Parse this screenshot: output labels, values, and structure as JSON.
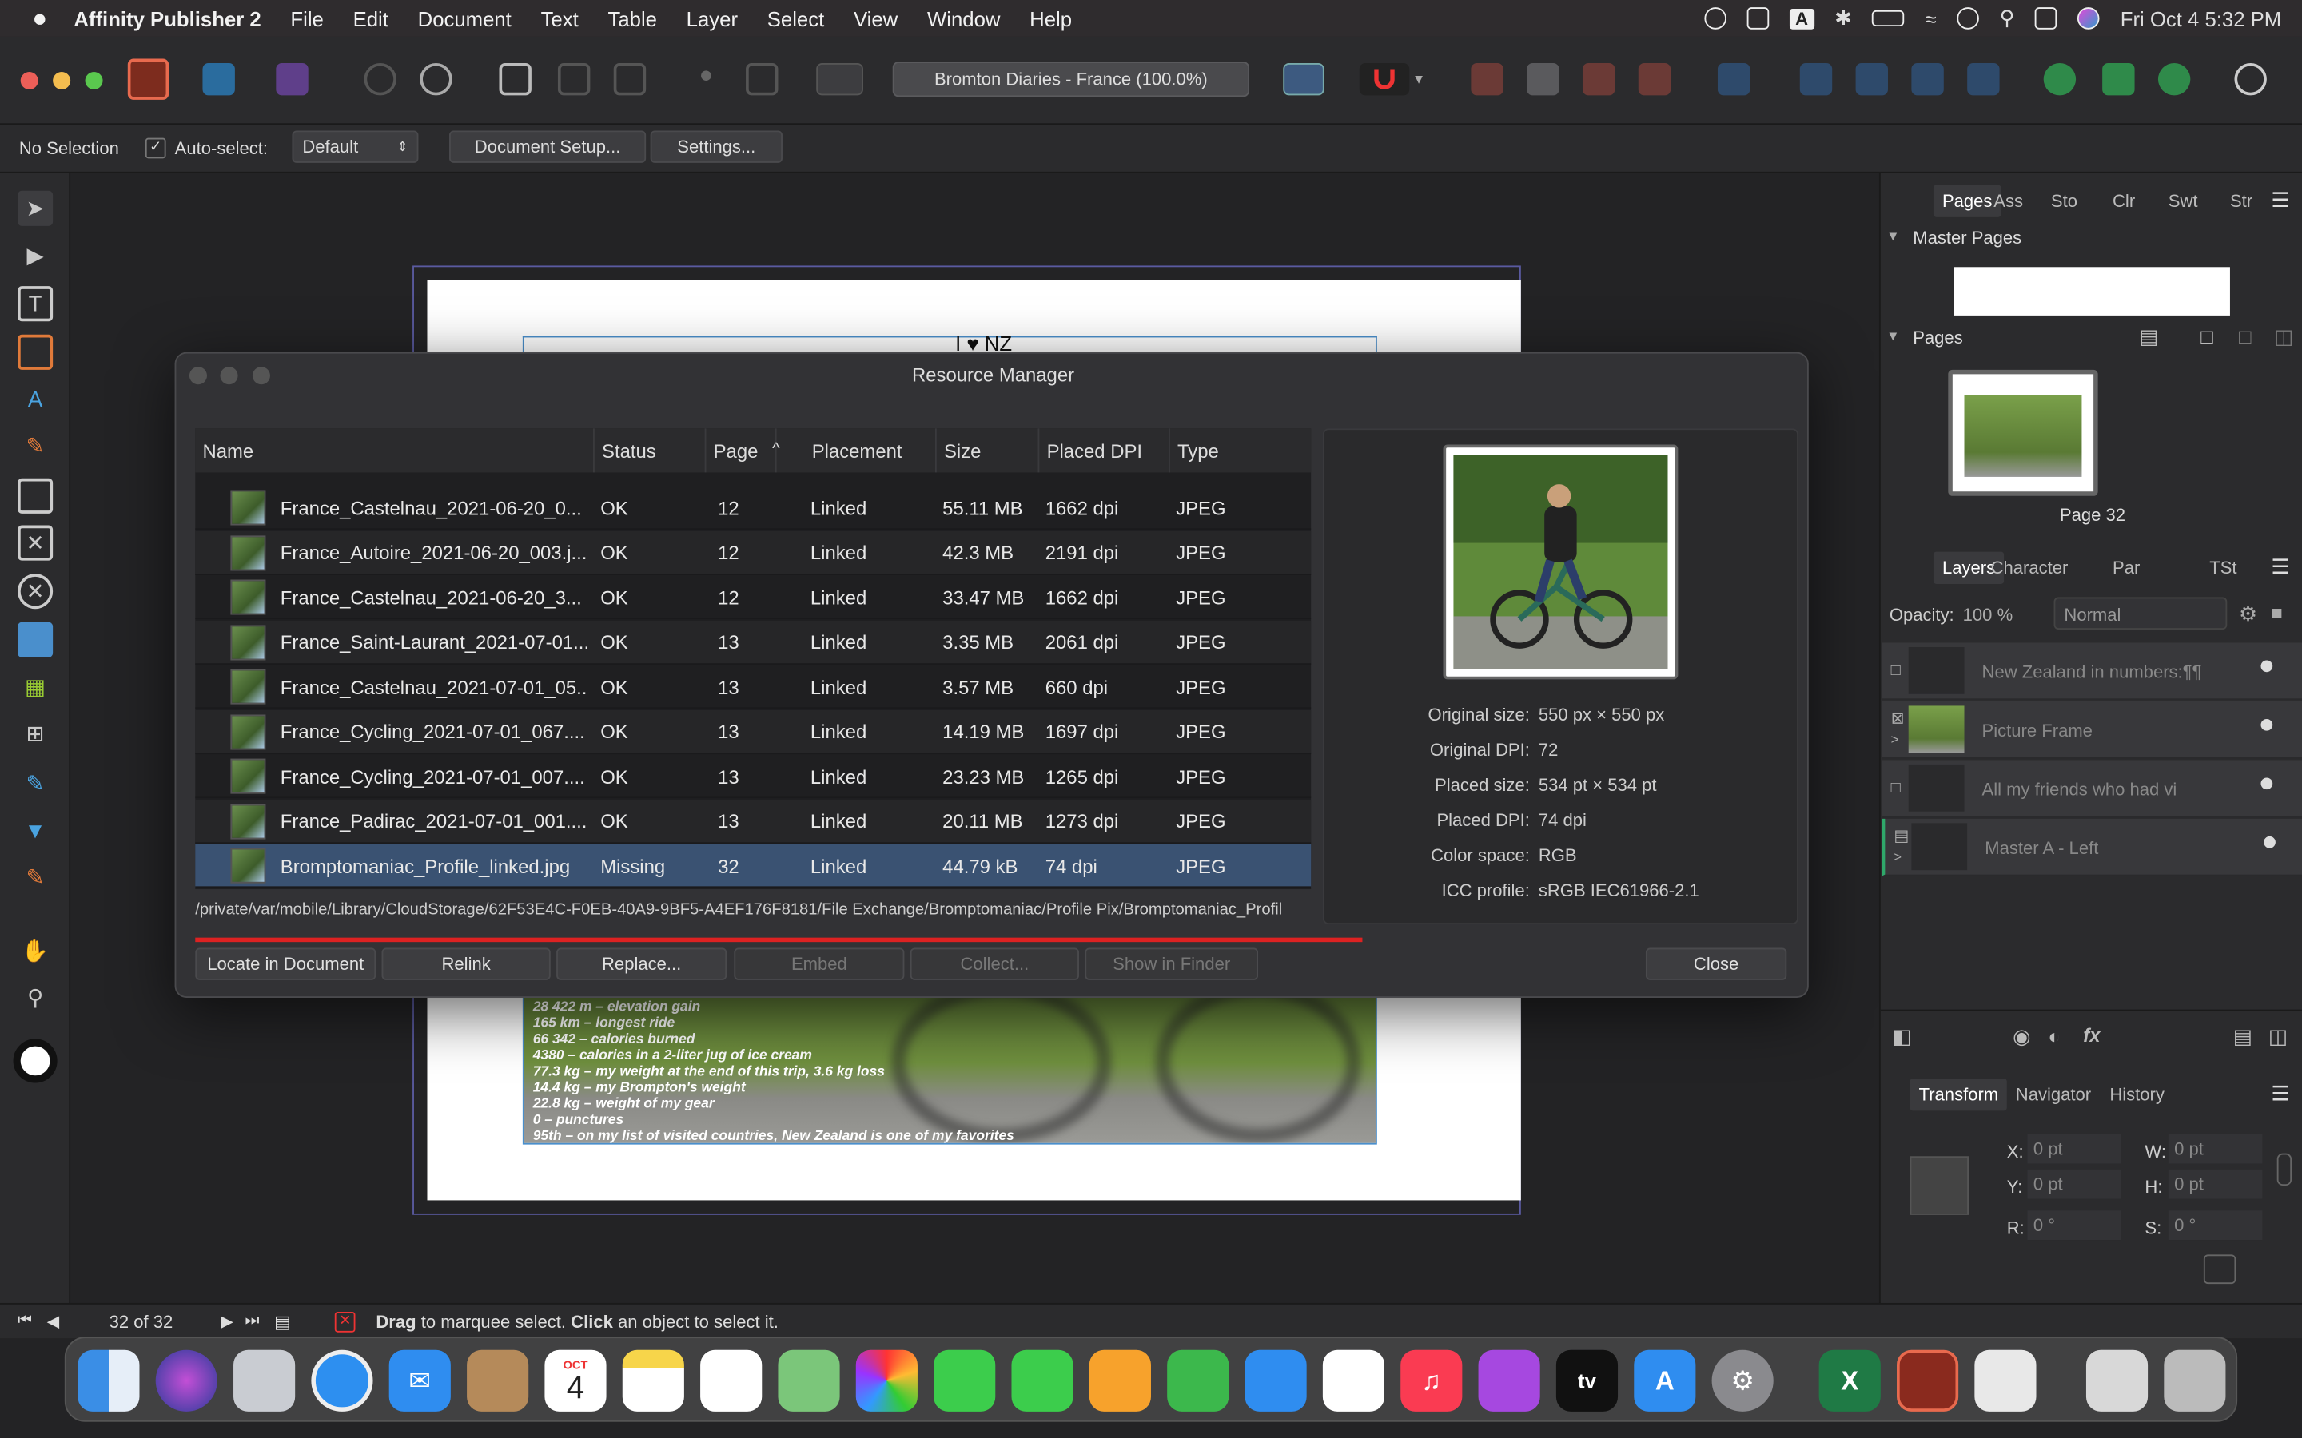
{
  "menubar": {
    "app": "Affinity Publisher 2",
    "items": [
      "File",
      "Edit",
      "Document",
      "Text",
      "Table",
      "Layer",
      "Select",
      "View",
      "Window",
      "Help"
    ],
    "clock": "Fri Oct 4  5:32 PM",
    "input_badge": "A"
  },
  "toolbar": {
    "doc_title": "Bromton Diaries - France (100.0%)"
  },
  "context": {
    "selection": "No Selection",
    "auto_select_label": "Auto-select:",
    "auto_select_value": "Default",
    "doc_setup": "Document Setup...",
    "settings": "Settings..."
  },
  "canvas": {
    "heading_fragment": "I ♥ NZ",
    "stats": [
      "28 422 m – elevation gain",
      "165 km – longest ride",
      "66 342 – calories burned",
      "4380 – calories in a 2-liter jug of ice cream",
      "77.3 kg – my weight at the end of this trip, 3.6 kg loss",
      "14.4 kg – my Brompton's weight",
      "22.8 kg – weight of my gear",
      "0 – punctures",
      "95th – on my list of visited countries, New Zealand is one of my favorites"
    ]
  },
  "dialog": {
    "title": "Resource Manager",
    "columns": [
      "Name",
      "Status",
      "Page",
      "Placement",
      "Size",
      "Placed DPI",
      "Type"
    ],
    "sort_arrow": "^",
    "rows": [
      {
        "name": "France_Castelnau_2021-06-20_0...",
        "status": "OK",
        "page": "12",
        "placement": "Linked",
        "size": "55.11 MB",
        "dpi": "1662 dpi",
        "type": "JPEG"
      },
      {
        "name": "France_Autoire_2021-06-20_003.j...",
        "status": "OK",
        "page": "12",
        "placement": "Linked",
        "size": "42.3 MB",
        "dpi": "2191 dpi",
        "type": "JPEG"
      },
      {
        "name": "France_Castelnau_2021-06-20_3...",
        "status": "OK",
        "page": "12",
        "placement": "Linked",
        "size": "33.47 MB",
        "dpi": "1662 dpi",
        "type": "JPEG"
      },
      {
        "name": "France_Saint-Laurant_2021-07-01...",
        "status": "OK",
        "page": "13",
        "placement": "Linked",
        "size": "3.35 MB",
        "dpi": "2061 dpi",
        "type": "JPEG"
      },
      {
        "name": "France_Castelnau_2021-07-01_05...",
        "status": "OK",
        "page": "13",
        "placement": "Linked",
        "size": "3.57 MB",
        "dpi": "660 dpi",
        "type": "JPEG"
      },
      {
        "name": "France_Cycling_2021-07-01_067....",
        "status": "OK",
        "page": "13",
        "placement": "Linked",
        "size": "14.19 MB",
        "dpi": "1697 dpi",
        "type": "JPEG"
      },
      {
        "name": "France_Cycling_2021-07-01_007....",
        "status": "OK",
        "page": "13",
        "placement": "Linked",
        "size": "23.23 MB",
        "dpi": "1265 dpi",
        "type": "JPEG"
      },
      {
        "name": "France_Padirac_2021-07-01_001....",
        "status": "OK",
        "page": "13",
        "placement": "Linked",
        "size": "20.11 MB",
        "dpi": "1273 dpi",
        "type": "JPEG"
      },
      {
        "name": "Bromptomaniac_Profile_linked.jpg",
        "status": "Missing",
        "page": "32",
        "placement": "Linked",
        "size": "44.79 kB",
        "dpi": "74 dpi",
        "type": "JPEG"
      }
    ],
    "info": [
      {
        "k": "Original size:",
        "v": "550 px × 550 px"
      },
      {
        "k": "Original DPI:",
        "v": "72"
      },
      {
        "k": "Placed size:",
        "v": "534 pt × 534 pt"
      },
      {
        "k": "Placed DPI:",
        "v": "74 dpi"
      },
      {
        "k": "Color space:",
        "v": "RGB"
      },
      {
        "k": "ICC profile:",
        "v": "sRGB IEC61966-2.1"
      }
    ],
    "path": "/private/var/mobile/Library/CloudStorage/62F53E4C-F0EB-40A9-9BF5-A4EF176F8181/File Exchange/Bromptomaniac/Profile Pix/Bromptomaniac_Profil",
    "buttons": {
      "locate": "Locate in Document",
      "relink": "Relink",
      "replace": "Replace...",
      "embed": "Embed",
      "collect": "Collect...",
      "finder": "Show in Finder",
      "close": "Close"
    }
  },
  "rpanel": {
    "tabs1": [
      "Pages",
      "Ass",
      "Sto",
      "Clr",
      "Swt",
      "Str"
    ],
    "master_pages": "Master Pages",
    "pages": "Pages",
    "page_label": "Page 32",
    "tabs2": [
      "Layers",
      "Character",
      "Par",
      "TSt"
    ],
    "opacity_label": "Opacity:",
    "opacity_value": "100 %",
    "blend": "Normal",
    "layers": [
      "New Zealand in numbers:¶¶",
      "Picture Frame",
      "All my friends who had vi",
      "Master A - Left"
    ],
    "tabs3": [
      "Transform",
      "Navigator",
      "History"
    ],
    "transform": {
      "x_label": "X:",
      "x": "0 pt",
      "y_label": "Y:",
      "y": "0 pt",
      "w_label": "W:",
      "w": "0 pt",
      "h_label": "H:",
      "h": "0 pt",
      "r_label": "R:",
      "r": "0 °",
      "s_label": "S:",
      "s": "0 °"
    }
  },
  "status": {
    "page_counter": "32 of 32",
    "hint_b1": "Drag",
    "hint_t1": " to marquee select. ",
    "hint_b2": "Click",
    "hint_t2": " an object to select it."
  },
  "dock": {
    "calendar_month": "OCT",
    "calendar_day": "4",
    "tv_label": "tv",
    "excel_label": "X"
  }
}
